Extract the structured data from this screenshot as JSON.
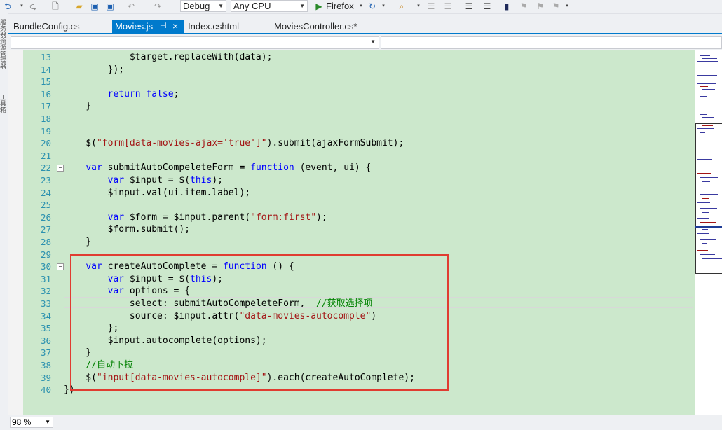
{
  "toolbar": {
    "config_value": "Debug",
    "platform_value": "Any CPU",
    "browser_label": "Firefox"
  },
  "side_panels": [
    "服务器资源管理器",
    "工具箱"
  ],
  "tabs": [
    {
      "label": "BundleConfig.cs",
      "active": false
    },
    {
      "label": "Movies.js",
      "active": true,
      "pin": "⊣",
      "close": "×"
    },
    {
      "label": "Index.cshtml",
      "active": false
    },
    {
      "label": "MoviesController.cs*",
      "active": false
    }
  ],
  "code_lines": [
    {
      "n": "13",
      "t": [
        [
          "p",
          "            $target.replaceWith(data);"
        ]
      ]
    },
    {
      "n": "14",
      "t": [
        [
          "p",
          "        });"
        ]
      ]
    },
    {
      "n": "15",
      "t": [
        [
          "p",
          ""
        ]
      ]
    },
    {
      "n": "16",
      "t": [
        [
          "p",
          "        "
        ],
        [
          "k",
          "return"
        ],
        [
          "p",
          " "
        ],
        [
          "k",
          "false"
        ],
        [
          "p",
          ";"
        ]
      ]
    },
    {
      "n": "17",
      "t": [
        [
          "p",
          "    }"
        ]
      ]
    },
    {
      "n": "18",
      "t": [
        [
          "p",
          ""
        ]
      ]
    },
    {
      "n": "19",
      "t": [
        [
          "p",
          ""
        ]
      ]
    },
    {
      "n": "20",
      "t": [
        [
          "p",
          "    $("
        ],
        [
          "s",
          "\"form[data-movies-ajax='true']\""
        ],
        [
          "p",
          ").submit(ajaxFormSubmit);"
        ]
      ]
    },
    {
      "n": "21",
      "t": [
        [
          "p",
          ""
        ]
      ]
    },
    {
      "n": "22",
      "t": [
        [
          "p",
          "    "
        ],
        [
          "k",
          "var"
        ],
        [
          "p",
          " submitAutoCompeleteForm = "
        ],
        [
          "k",
          "function"
        ],
        [
          "p",
          " (event, ui) {"
        ]
      ]
    },
    {
      "n": "23",
      "t": [
        [
          "p",
          "        "
        ],
        [
          "k",
          "var"
        ],
        [
          "p",
          " $input = $("
        ],
        [
          "k",
          "this"
        ],
        [
          "p",
          ");"
        ]
      ]
    },
    {
      "n": "24",
      "t": [
        [
          "p",
          "        $input.val(ui.item.label);"
        ]
      ]
    },
    {
      "n": "25",
      "t": [
        [
          "p",
          ""
        ]
      ]
    },
    {
      "n": "26",
      "t": [
        [
          "p",
          "        "
        ],
        [
          "k",
          "var"
        ],
        [
          "p",
          " $form = $input.parent("
        ],
        [
          "s",
          "\"form:first\""
        ],
        [
          "p",
          ");"
        ]
      ]
    },
    {
      "n": "27",
      "t": [
        [
          "p",
          "        $form.submit();"
        ]
      ]
    },
    {
      "n": "28",
      "t": [
        [
          "p",
          "    }"
        ]
      ]
    },
    {
      "n": "29",
      "t": [
        [
          "p",
          ""
        ]
      ]
    },
    {
      "n": "30",
      "t": [
        [
          "p",
          "    "
        ],
        [
          "k",
          "var"
        ],
        [
          "p",
          " createAutoComplete = "
        ],
        [
          "k",
          "function"
        ],
        [
          "p",
          " () {"
        ]
      ]
    },
    {
      "n": "31",
      "t": [
        [
          "p",
          "        "
        ],
        [
          "k",
          "var"
        ],
        [
          "p",
          " $input = $("
        ],
        [
          "k",
          "this"
        ],
        [
          "p",
          ");"
        ]
      ]
    },
    {
      "n": "32",
      "t": [
        [
          "p",
          "        "
        ],
        [
          "k",
          "var"
        ],
        [
          "p",
          " options = {"
        ]
      ]
    },
    {
      "n": "33",
      "t": [
        [
          "p",
          "            select: submitAutoCompeleteForm,  "
        ],
        [
          "c",
          "//获取选择项"
        ]
      ]
    },
    {
      "n": "34",
      "t": [
        [
          "p",
          "            source: $input.attr("
        ],
        [
          "s",
          "\"data-movies-autocomple\""
        ],
        [
          "p",
          ")"
        ]
      ]
    },
    {
      "n": "35",
      "t": [
        [
          "p",
          "        };"
        ]
      ]
    },
    {
      "n": "36",
      "t": [
        [
          "p",
          "        $input.autocomplete(options);"
        ]
      ]
    },
    {
      "n": "37",
      "t": [
        [
          "p",
          "    }"
        ]
      ]
    },
    {
      "n": "38",
      "t": [
        [
          "c",
          "    //自动下拉"
        ]
      ]
    },
    {
      "n": "39",
      "t": [
        [
          "p",
          "    $("
        ],
        [
          "s",
          "\"input[data-movies-autocomple]\""
        ],
        [
          "p",
          ").each(createAutoComplete);"
        ]
      ]
    },
    {
      "n": "40",
      "t": [
        [
          "p",
          "})"
        ]
      ]
    }
  ],
  "status": {
    "zoom": "98 %"
  },
  "colors": {
    "editor_bg": "#cce8cc",
    "keyword": "#0000ff",
    "string": "#a31515",
    "comment": "#008000",
    "line_number": "#2b91af",
    "accent": "#007acc",
    "highlight_box": "#e03c31"
  }
}
